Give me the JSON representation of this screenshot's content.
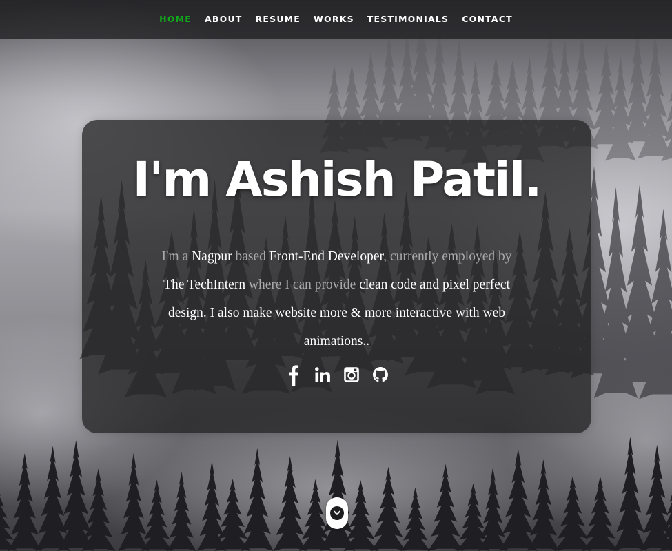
{
  "nav": {
    "items": [
      {
        "label": "HOME",
        "active": true
      },
      {
        "label": "ABOUT"
      },
      {
        "label": "RESUME"
      },
      {
        "label": "WORKS"
      },
      {
        "label": "TESTIMONIALS"
      },
      {
        "label": "CONTACT"
      }
    ],
    "active_color": "#11a81b"
  },
  "banner": {
    "headline": "I'm Ashish Patil.",
    "intro": {
      "p1": "I'm a ",
      "city": "Nagpur",
      "p2": " based ",
      "role": "Front-End Developer",
      "p3": ", currently employed by ",
      "company": "The TechIntern",
      "p4": " where I can provide ",
      "p5": "clean code and pixel perfect design. I also make website more & more interactive with web animations.."
    }
  },
  "social": [
    {
      "name": "facebook",
      "icon": "facebook-icon"
    },
    {
      "name": "linkedin",
      "icon": "linkedin-icon"
    },
    {
      "name": "instagram",
      "icon": "instagram-icon"
    },
    {
      "name": "github",
      "icon": "github-icon"
    }
  ],
  "scroll_button": {
    "icon": "chevron-down-icon"
  },
  "colors": {
    "text_primary": "#ffffff",
    "text_muted": "#a9a9ad",
    "card_background": "rgba(32,32,34,0.74)"
  }
}
